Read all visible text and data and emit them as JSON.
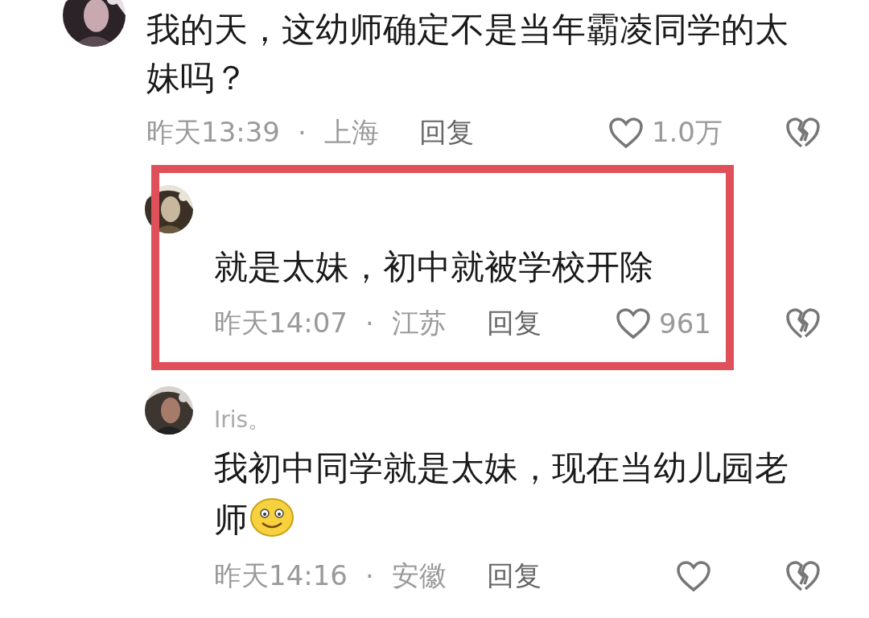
{
  "comments": [
    {
      "kind": "comment",
      "text": "我的天，这幼师确定不是当年霸凌同学的太妹吗？",
      "time": "昨天13:39",
      "separator": "·",
      "location": "上海",
      "reply_label": "回复",
      "likes": "1.0万",
      "highlighted": false
    },
    {
      "kind": "reply",
      "text": "就是太妹，初中就被学校开除",
      "time": "昨天14:07",
      "separator": "·",
      "location": "江苏",
      "reply_label": "回复",
      "likes": "961",
      "highlighted": true
    },
    {
      "kind": "reply",
      "username": "Iris。",
      "text": "我初中同学就是太妹，现在当幼儿园老师",
      "emoji": true,
      "time": "昨天14:16",
      "separator": "·",
      "location": "安徽",
      "reply_label": "回复",
      "highlighted": false
    }
  ]
}
